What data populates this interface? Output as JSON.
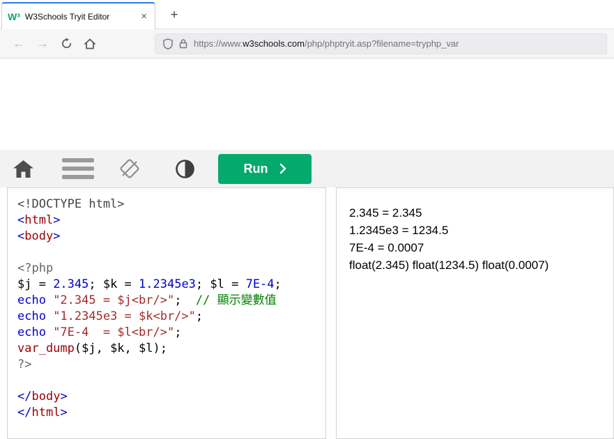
{
  "colors": {
    "accent": "#04AA6D",
    "doc": "#444444",
    "meta": "#666666",
    "pun": "#0000cd",
    "tag": "#990000",
    "kw": "#0000cd",
    "num": "#0000cd",
    "str": "#a52a2a",
    "com": "#008000",
    "fn": "#990000",
    "plain": "#000000"
  },
  "browser": {
    "tab": {
      "title": "W3Schools Tryit Editor",
      "favicon_text": "W³",
      "close_glyph": "×",
      "new_tab_glyph": "+"
    },
    "nav": {
      "back_glyph": "←",
      "forward_glyph": "→"
    },
    "url": {
      "prefix": "https://www.",
      "domain": "w3schools.com",
      "path": "/php/phptryit.asp?filename=tryphp_var"
    }
  },
  "toolbar": {
    "run_label": "Run"
  },
  "editor": {
    "lines": [
      [
        {
          "c": "doc",
          "t": "<!DOCTYPE html>"
        }
      ],
      [
        {
          "c": "pun",
          "t": "<"
        },
        {
          "c": "tag",
          "t": "html"
        },
        {
          "c": "pun",
          "t": ">"
        }
      ],
      [
        {
          "c": "pun",
          "t": "<"
        },
        {
          "c": "tag",
          "t": "body"
        },
        {
          "c": "pun",
          "t": ">"
        }
      ],
      [],
      [
        {
          "c": "meta",
          "t": "<?php"
        }
      ],
      [
        {
          "c": "plain",
          "t": "$j = "
        },
        {
          "c": "num",
          "t": "2.345"
        },
        {
          "c": "plain",
          "t": "; $k = "
        },
        {
          "c": "num",
          "t": "1.2345e3"
        },
        {
          "c": "plain",
          "t": "; $l = "
        },
        {
          "c": "num",
          "t": "7E-4"
        },
        {
          "c": "plain",
          "t": ";"
        }
      ],
      [
        {
          "c": "kw",
          "t": "echo "
        },
        {
          "c": "str",
          "t": "\"2.345 = $j<br/>\""
        },
        {
          "c": "plain",
          "t": ";  "
        },
        {
          "c": "com",
          "t": "// 顯示變數值"
        }
      ],
      [
        {
          "c": "kw",
          "t": "echo "
        },
        {
          "c": "str",
          "t": "\"1.2345e3 = $k<br/>\""
        },
        {
          "c": "plain",
          "t": ";"
        }
      ],
      [
        {
          "c": "kw",
          "t": "echo "
        },
        {
          "c": "str",
          "t": "\"7E-4  = $l<br/>\""
        },
        {
          "c": "plain",
          "t": ";"
        }
      ],
      [
        {
          "c": "fn",
          "t": "var_dump"
        },
        {
          "c": "plain",
          "t": "($j, $k, $l);"
        }
      ],
      [
        {
          "c": "meta",
          "t": "?>"
        }
      ],
      [],
      [
        {
          "c": "pun",
          "t": "</"
        },
        {
          "c": "tag",
          "t": "body"
        },
        {
          "c": "pun",
          "t": ">"
        }
      ],
      [
        {
          "c": "pun",
          "t": "</"
        },
        {
          "c": "tag",
          "t": "html"
        },
        {
          "c": "pun",
          "t": ">"
        }
      ]
    ]
  },
  "output": {
    "lines": [
      "2.345 = 2.345",
      "1.2345e3 = 1234.5",
      "7E-4 = 0.0007",
      "float(2.345) float(1234.5) float(0.0007)"
    ]
  }
}
